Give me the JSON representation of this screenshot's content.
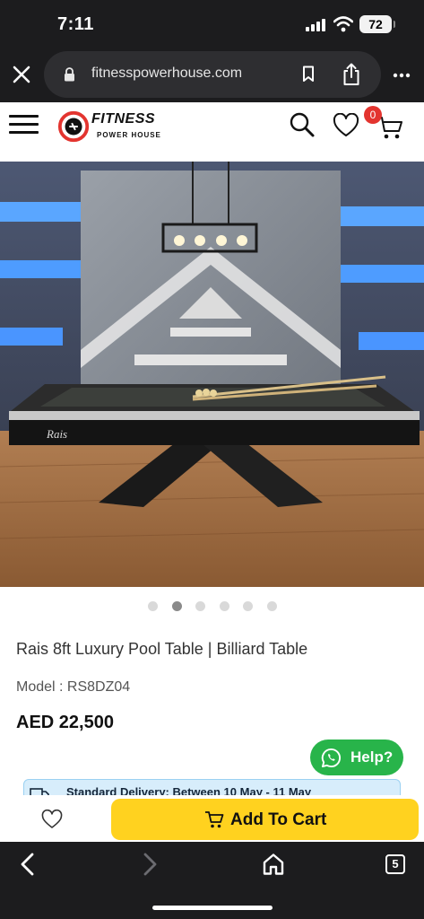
{
  "status_bar": {
    "time": "7:11",
    "battery": "72"
  },
  "browser": {
    "url": "fitnesspowerhouse.com",
    "tab_count": "5"
  },
  "site": {
    "logo_title": "FITNESS",
    "logo_subtitle": "POWER HOUSE",
    "cart_count": "0"
  },
  "product": {
    "title": "Rais 8ft Luxury Pool Table | Billiard Table",
    "model": "Model : RS8DZ04",
    "price": "AED 22,500",
    "table_brand": "Rais",
    "carousel_total": 6,
    "carousel_active": 2
  },
  "help": {
    "label": "Help?"
  },
  "delivery": {
    "text": "Standard Delivery: Between 10 May - 11 May"
  },
  "actions": {
    "add_to_cart": "Add To Cart"
  },
  "colors": {
    "accent_yellow": "#ffd21f",
    "help_green": "#28b44a",
    "badge_red": "#e3342f",
    "chrome_dark": "#1c1c1e",
    "delivery_bg": "#d7edfb"
  },
  "icons": [
    "close-icon",
    "lock-icon",
    "bookmark-icon",
    "share-icon",
    "more-icon",
    "hamburger-icon",
    "search-icon",
    "heart-icon",
    "cart-icon",
    "whatsapp-icon",
    "truck-icon",
    "add-cart-icon",
    "back-icon",
    "forward-icon",
    "home-icon"
  ]
}
